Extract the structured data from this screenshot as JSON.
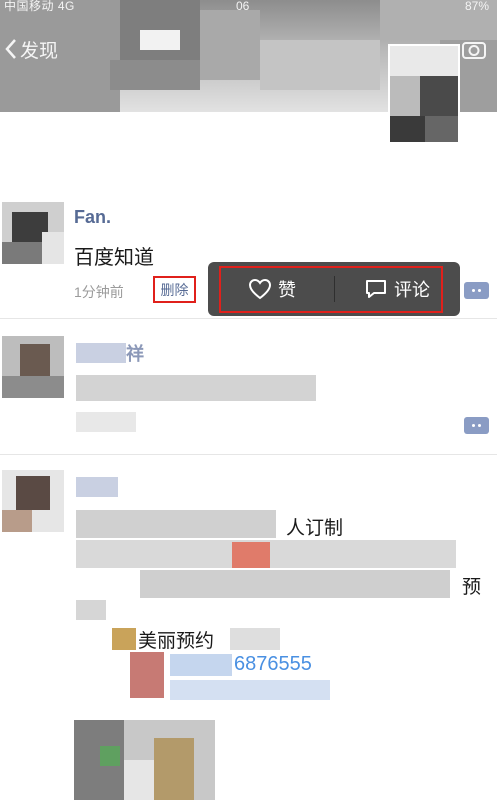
{
  "status_bar": {
    "carrier": "中国移动 4G",
    "time": "06",
    "battery": "87%"
  },
  "nav": {
    "back_label": "发现"
  },
  "posts": [
    {
      "name": "Fan.",
      "text": "百度知道",
      "time": "1分钟前",
      "delete_label": "删除"
    },
    {
      "name_partial": "祥"
    },
    {
      "text_fragment": "人订制",
      "fragment_2": "预",
      "fragment_3": "美丽预约",
      "phone": "6876555"
    }
  ],
  "actions": {
    "like_label": "赞",
    "comment_label": "评论"
  },
  "colors": {
    "name_blue": "#576b95",
    "highlight_red": "#e0201b",
    "action_bar_bg": "#4c4c4c",
    "link_blue": "#4a90e2"
  }
}
